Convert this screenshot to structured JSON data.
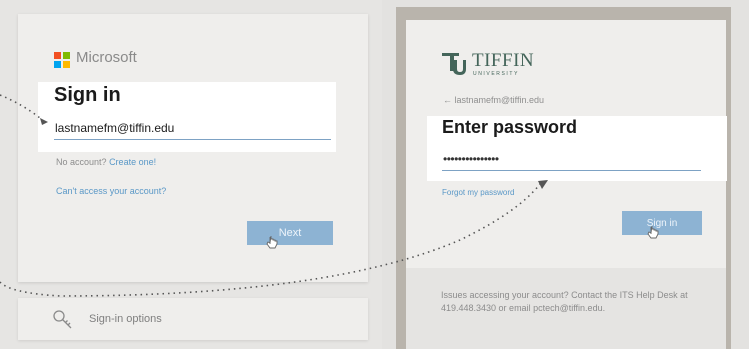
{
  "left_panel": {
    "brand": "Microsoft",
    "title": "Sign in",
    "email_value": "lastnamefm@tiffin.edu",
    "no_account_text": "No account?",
    "create_link": "Create one!",
    "cant_access_link": "Can't access your account?",
    "next_label": "Next",
    "options_label": "Sign-in options"
  },
  "right_panel": {
    "brand": "TIFFIN",
    "brand_sub": "UNIVERSITY",
    "back_email": "← lastnamefm@tiffin.edu",
    "title": "Enter password",
    "password_value": "•••••••••••••••",
    "forgot_link": "Forgot my password",
    "signin_label": "Sign in",
    "issues_text": "Issues accessing your account? Contact the ITS Help Desk at 419.448.3430 or email pctech@tiffin.edu."
  },
  "colors": {
    "ms_red": "#f25022",
    "ms_green": "#7fba00",
    "ms_blue": "#00a4ef",
    "ms_yellow": "#ffb900",
    "button_blue": "#8db3d3",
    "link_blue": "#5a98c7",
    "tiffin_green": "#44655a"
  }
}
